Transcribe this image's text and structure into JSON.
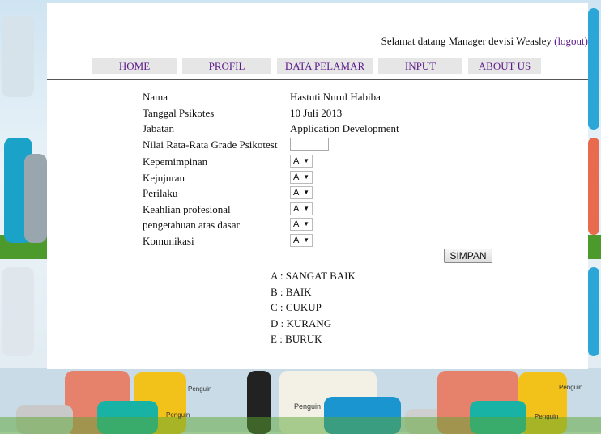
{
  "header": {
    "welcome": "Selamat datang Manager devisi Weasley",
    "logout": "(logout)"
  },
  "nav": [
    {
      "label": "HOME"
    },
    {
      "label": "PROFIL"
    },
    {
      "label": "DATA PELAMAR"
    },
    {
      "label": "INPUT"
    },
    {
      "label": "ABOUT US"
    }
  ],
  "info": {
    "name_label": "Nama",
    "name_value": "Hastuti Nurul Habiba",
    "date_label": "Tanggal Psikotes",
    "date_value": "10 Juli 2013",
    "position_label": "Jabatan",
    "position_value": "Application Development",
    "avg_label": "Nilai Rata-Rata Grade Psikotest",
    "avg_value": ""
  },
  "grades": [
    {
      "label": "Kepemimpinan",
      "value": "A"
    },
    {
      "label": "Kejujuran",
      "value": "A"
    },
    {
      "label": "Perilaku",
      "value": "A"
    },
    {
      "label": "Keahlian profesional",
      "value": "A"
    },
    {
      "label": "pengetahuan atas dasar",
      "value": "A"
    },
    {
      "label": "Komunikasi",
      "value": "A"
    }
  ],
  "save_label": "SIMPAN",
  "legend": [
    "A : SANGAT BAIK",
    "B : BAIK",
    "C : CUKUP",
    "D : KURANG",
    "E : BURUK"
  ],
  "branding": {
    "logo_text": "Penguin"
  }
}
